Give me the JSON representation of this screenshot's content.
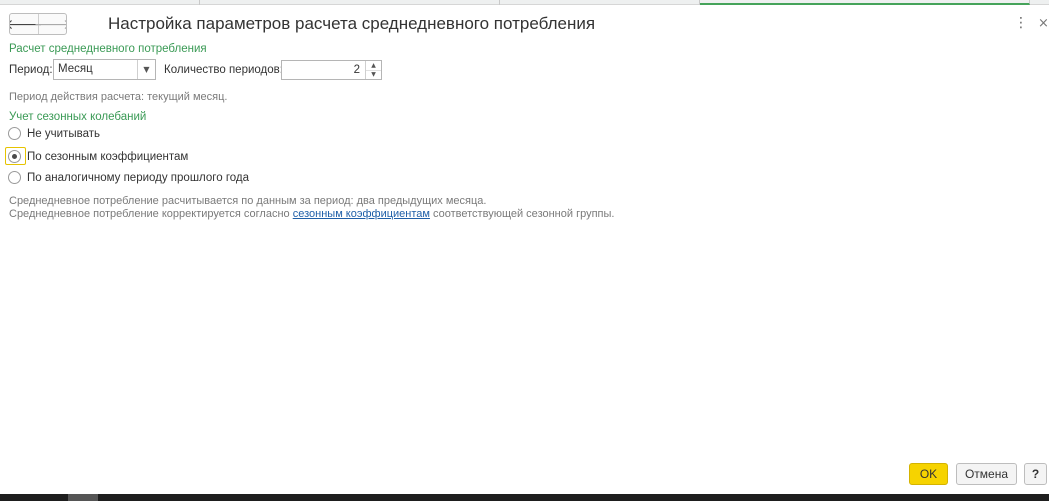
{
  "window": {
    "title": "Настройка параметров расчета среднедневного потребления",
    "back_symbol": "🡐",
    "forward_symbol": "🡒",
    "menu_symbol": "⋮",
    "close_symbol": "×"
  },
  "calc_section": {
    "title": "Расчет среднедневного потребления",
    "period_label": "Период:",
    "period_value": "Месяц",
    "count_label": "Количество периодов:",
    "count_value": "2",
    "hint": "Период действия расчета: текущий месяц."
  },
  "seasonal_section": {
    "title": "Учет сезонных колебаний",
    "options": [
      {
        "label": "Не учитывать",
        "checked": false
      },
      {
        "label": "По сезонным коэффициентам",
        "checked": true
      },
      {
        "label": "По аналогичному периоду прошлого года",
        "checked": false
      }
    ]
  },
  "notes": {
    "line1": "Среднедневное потребление расчитывается по данным за период: два предыдущих месяца.",
    "line2_prefix": "Среднедневное потребление корректируется согласно ",
    "line2_link": "сезонным коэффициентам",
    "line2_suffix": " соответствующей сезонной группы."
  },
  "footer": {
    "ok_label": "OK",
    "cancel_label": "Отмена",
    "help_label": "?"
  },
  "colors": {
    "accent_green": "#3a9a55",
    "ok_yellow": "#f6d300",
    "link_blue": "#1f5fa8"
  }
}
